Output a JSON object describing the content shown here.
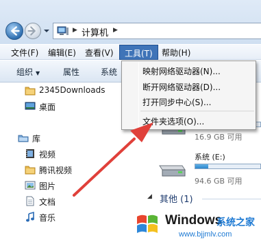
{
  "address_bar": {
    "path": "计算机",
    "icons": [
      "back-arrow-icon",
      "forward-arrow-icon",
      "computer-icon"
    ]
  },
  "menubar": {
    "items": [
      {
        "label": "文件(F)"
      },
      {
        "label": "编辑(E)"
      },
      {
        "label": "查看(V)"
      },
      {
        "label": "工具(T)",
        "active": true
      },
      {
        "label": "帮助(H)"
      }
    ]
  },
  "command_bar": {
    "organize_label": "组织",
    "properties_label": "属性",
    "system_label": "系统"
  },
  "tools_menu": {
    "items": [
      {
        "label": "映射网络驱动器(N)..."
      },
      {
        "label": "断开网络驱动器(D)..."
      },
      {
        "label": "打开同步中心(S)..."
      },
      {
        "label": "文件夹选项(O)..."
      }
    ]
  },
  "nav_pane": {
    "items": [
      {
        "label": "2345Downloads",
        "icon": "folder-icon"
      },
      {
        "label": "桌面",
        "icon": "desktop-icon"
      },
      {
        "label": "库",
        "icon": "library-icon"
      },
      {
        "label": "视频",
        "icon": "video-library-icon"
      },
      {
        "label": "腾讯视频",
        "icon": "folder-icon"
      },
      {
        "label": "图片",
        "icon": "pictures-library-icon"
      },
      {
        "label": "文档",
        "icon": "documents-library-icon"
      },
      {
        "label": "音乐",
        "icon": "music-library-icon"
      }
    ]
  },
  "content": {
    "drive_c_free": "16.9 GB 可用",
    "drive_e": {
      "name": "系统 (E:)",
      "free": "94.6 GB 可用",
      "used_fraction": 0.2
    },
    "drive_d_used_fraction": 0.55,
    "group_other": "其他 (1)"
  },
  "watermark": {
    "brand": "Windows",
    "brand_cn": "系统之家",
    "url": "www.bjjmlv.com"
  },
  "colors": {
    "menu_highlight": "#3f74b8",
    "annotation_arrow": "#e0403a",
    "drive_bar_fill": "#2c86cc",
    "watermark_blue": "#1e7ad3"
  }
}
